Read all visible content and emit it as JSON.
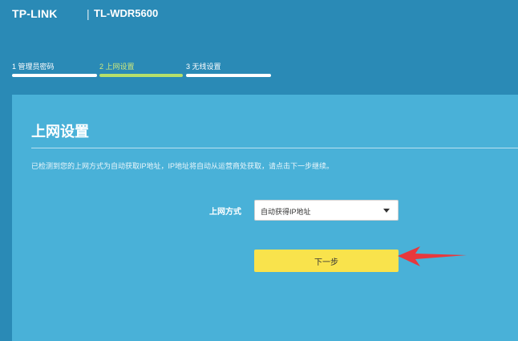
{
  "header": {
    "brand": "TP-LINK",
    "separator": "|",
    "model": "TL-WDR5600"
  },
  "steps": [
    {
      "label": "1 管理员密码",
      "active": false
    },
    {
      "label": "2 上网设置",
      "active": true
    },
    {
      "label": "3 无线设置",
      "active": false
    }
  ],
  "panel": {
    "title": "上网设置",
    "description": "已检测到您的上网方式为自动获取IP地址，IP地址将自动从运营商处获取，请点击下一步继续。",
    "connection_label": "上网方式",
    "connection_select": {
      "selected": "自动获得IP地址",
      "icon": "chevron-down-icon"
    },
    "next_button_label": "下一步"
  },
  "colors": {
    "background": "#2a8ab6",
    "panel": "#49b1d8",
    "active_step": "#b6e06a",
    "button": "#f9e34c",
    "annotation_arrow": "#e8383d"
  }
}
